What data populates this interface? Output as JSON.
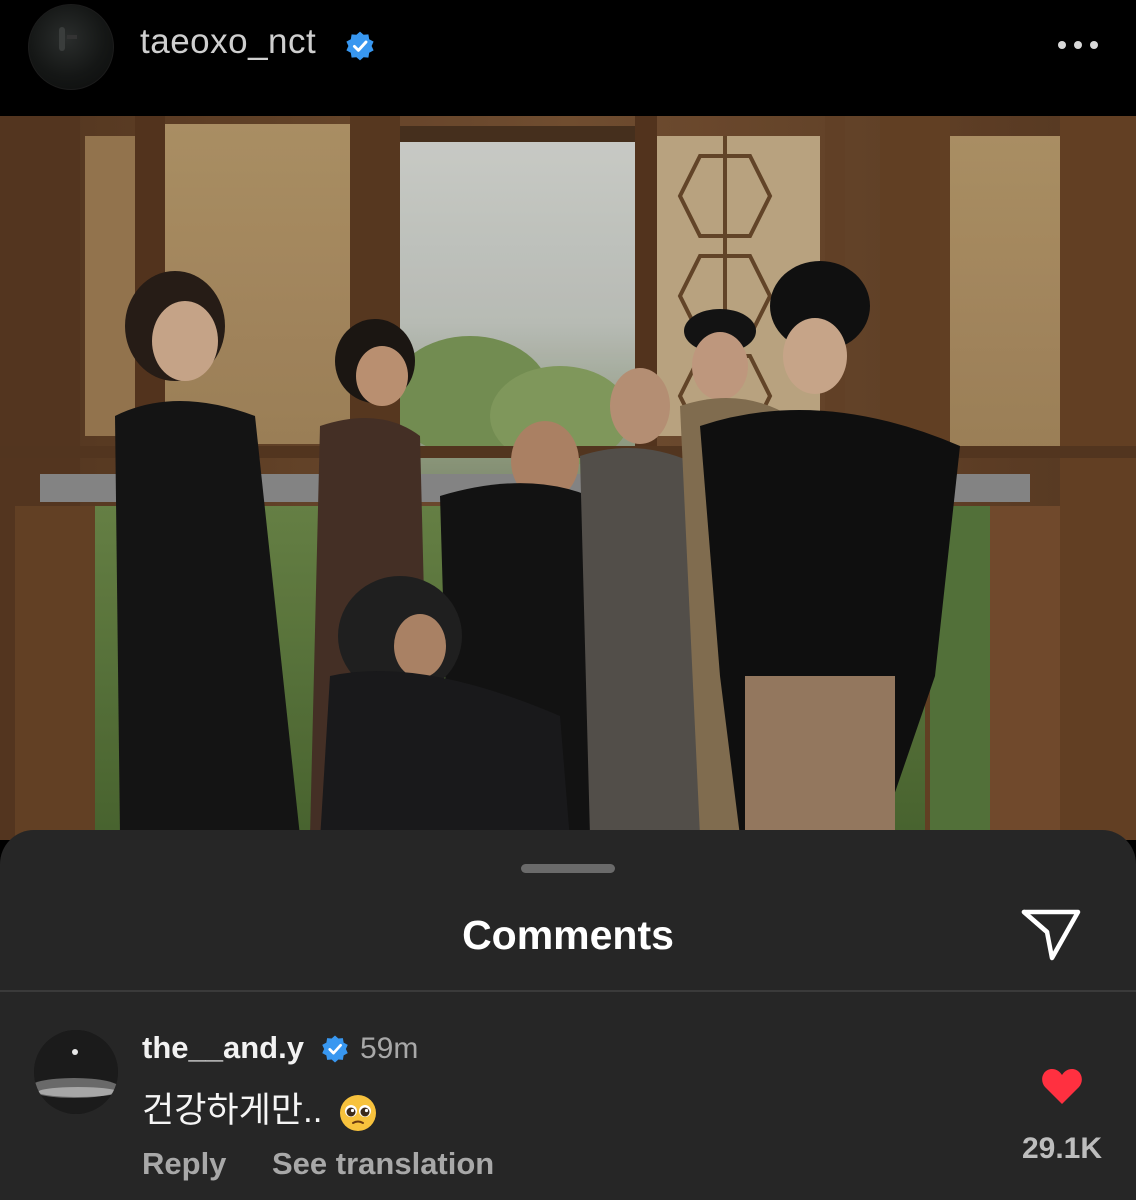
{
  "post": {
    "username": "taeoxo_nct",
    "verified": true,
    "more_icon": "more-horizontal-icon"
  },
  "comments_sheet": {
    "title": "Comments",
    "share_icon": "paper-plane-icon"
  },
  "comments": [
    {
      "username": "the__and.y",
      "verified": true,
      "time": "59m",
      "text": "건강하게만..",
      "emoji": "pleading-face",
      "reply_label": "Reply",
      "translate_label": "See translation",
      "likes": "29.1K",
      "liked": true
    }
  ],
  "colors": {
    "verified_blue": "#3897f0",
    "heart_red": "#ff3040",
    "sheet_bg": "#262626"
  }
}
